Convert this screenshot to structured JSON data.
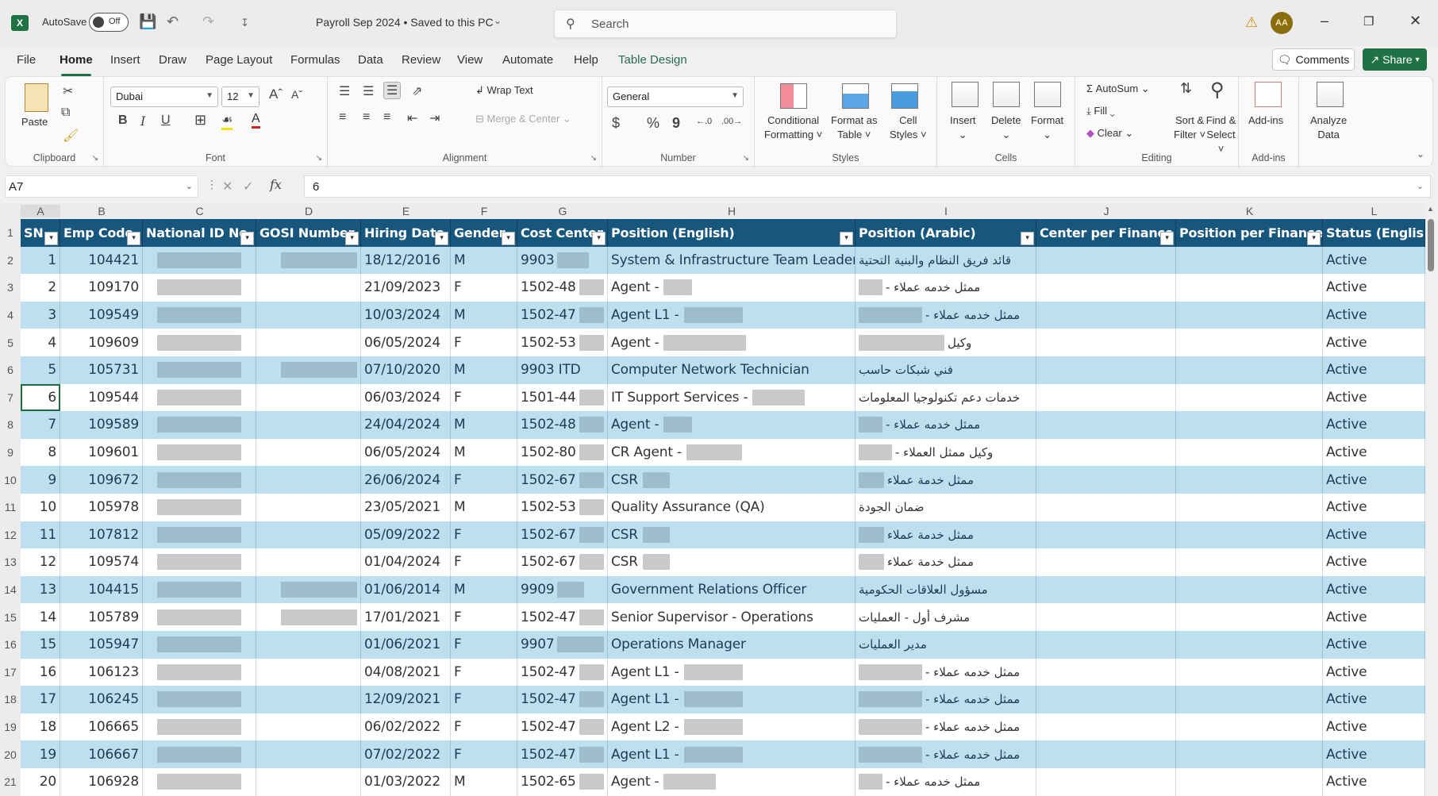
{
  "titlebar": {
    "app_icon": "X",
    "autosave_label": "AutoSave",
    "autosave_state": "Off",
    "doc_title": "Payroll Sep 2024 • Saved to this PC",
    "search_placeholder": "Search",
    "avatar_initials": "AA"
  },
  "tabs": [
    "File",
    "Home",
    "Insert",
    "Draw",
    "Page Layout",
    "Formulas",
    "Data",
    "Review",
    "View",
    "Automate",
    "Help",
    "Table Design"
  ],
  "active_tab": "Home",
  "actions": {
    "comments": "Comments",
    "share": "Share"
  },
  "ribbon": {
    "clipboard": {
      "label": "Clipboard",
      "paste": "Paste"
    },
    "font": {
      "label": "Font",
      "font_name": "Dubai",
      "font_size": "12",
      "bold": "B",
      "italic": "I",
      "underline": "U"
    },
    "alignment": {
      "label": "Alignment",
      "wrap_text": "Wrap Text",
      "merge_center": "Merge & Center"
    },
    "number": {
      "label": "Number",
      "format": "General",
      "currency": "$",
      "percent": "%",
      "comma": "9"
    },
    "styles": {
      "label": "Styles",
      "conditional": [
        "Conditional",
        "Formatting ˅"
      ],
      "format_table": [
        "Format as",
        "Table ˅"
      ],
      "cell_styles": [
        "Cell",
        "Styles ˅"
      ]
    },
    "cells": {
      "label": "Cells",
      "insert": "Insert",
      "delete": "Delete",
      "format": "Format"
    },
    "editing": {
      "label": "Editing",
      "autosum": "AutoSum",
      "fill": "Fill",
      "clear": "Clear",
      "sort_filter": [
        "Sort &",
        "Filter ˅"
      ],
      "find_select": [
        "Find &",
        "Select ˅"
      ]
    },
    "addins": {
      "label": "Add-ins",
      "addins": "Add-ins"
    },
    "analyze": {
      "label": [
        "Analyze",
        "Data"
      ]
    }
  },
  "formula_bar": {
    "name_box": "A7",
    "fx": "fx",
    "value": "6"
  },
  "columns": [
    "A",
    "B",
    "C",
    "D",
    "E",
    "F",
    "G",
    "H",
    "I",
    "J",
    "K",
    "L"
  ],
  "table": {
    "headers": [
      "SN",
      "Emp Code",
      "National ID No",
      "GOSI Number",
      "Hiring Date",
      "Gender",
      "Cost Center",
      "Position (English)",
      "Position (Arabic)",
      "Center per Finance",
      "Position per Finance",
      "Status (English"
    ],
    "rows": [
      {
        "sn": "1",
        "code": "104421",
        "gosi": true,
        "date": "18/12/2016",
        "g": "M",
        "cc": "9903",
        "ccb": 40,
        "pos": "System & Infrastructure Team Leader",
        "posb": 0,
        "ar": "قائد فريق النظام والبنية التحتية",
        "arb": 0,
        "status": "Active"
      },
      {
        "sn": "2",
        "code": "109170",
        "gosi": false,
        "date": "21/09/2023",
        "g": "F",
        "cc": "1502-48",
        "ccb": 36,
        "pos": "Agent -",
        "posb": 36,
        "ar": "ممثل خدمه عملاء -",
        "arb": 30,
        "status": "Active"
      },
      {
        "sn": "3",
        "code": "109549",
        "gosi": false,
        "date": "10/03/2024",
        "g": "M",
        "cc": "1502-47",
        "ccb": 36,
        "pos": "Agent L1 -",
        "posb": 74,
        "ar": "ممثل خدمه عملاء -",
        "arb": 80,
        "status": "Active"
      },
      {
        "sn": "4",
        "code": "109609",
        "gosi": false,
        "date": "06/05/2024",
        "g": "F",
        "cc": "1502-53",
        "ccb": 36,
        "pos": "Agent -",
        "posb": 104,
        "ar": "وكيل",
        "arb": 108,
        "status": "Active"
      },
      {
        "sn": "5",
        "code": "105731",
        "gosi": true,
        "date": "07/10/2020",
        "g": "M",
        "cc": "9903 ITD",
        "ccb": 0,
        "pos": "Computer Network Technician",
        "posb": 0,
        "ar": "فني شبكات حاسب",
        "arb": 0,
        "status": "Active"
      },
      {
        "sn": "6",
        "code": "109544",
        "gosi": false,
        "date": "06/03/2024",
        "g": "F",
        "cc": "1501-44",
        "ccb": 36,
        "pos": "IT Support Services -",
        "posb": 66,
        "ar": "خدمات دعم تكنولوجيا المعلومات",
        "arb": 0,
        "status": "Active"
      },
      {
        "sn": "7",
        "code": "109589",
        "gosi": false,
        "date": "24/04/2024",
        "g": "M",
        "cc": "1502-48",
        "ccb": 36,
        "pos": "Agent -",
        "posb": 36,
        "ar": "ممثل خدمه عملاء -",
        "arb": 30,
        "status": "Active"
      },
      {
        "sn": "8",
        "code": "109601",
        "gosi": false,
        "date": "06/05/2024",
        "g": "M",
        "cc": "1502-80",
        "ccb": 36,
        "pos": "CR Agent -",
        "posb": 70,
        "ar": "وكيل ممثل العملاء -",
        "arb": 42,
        "status": "Active"
      },
      {
        "sn": "9",
        "code": "109672",
        "gosi": false,
        "date": "26/06/2024",
        "g": "F",
        "cc": "1502-67",
        "ccb": 36,
        "pos": "CSR",
        "posb": 34,
        "ar": "ممثل خدمة عملاء",
        "arb": 32,
        "status": "Active"
      },
      {
        "sn": "10",
        "code": "105978",
        "gosi": false,
        "date": "23/05/2021",
        "g": "M",
        "cc": "1502-53",
        "ccb": 36,
        "pos": "Quality Assurance (QA)",
        "posb": 0,
        "ar": "ضمان الجودة",
        "arb": 0,
        "status": "Active"
      },
      {
        "sn": "11",
        "code": "107812",
        "gosi": false,
        "date": "05/09/2022",
        "g": "F",
        "cc": "1502-67",
        "ccb": 36,
        "pos": "CSR",
        "posb": 34,
        "ar": "ممثل خدمة عملاء",
        "arb": 32,
        "status": "Active"
      },
      {
        "sn": "12",
        "code": "109574",
        "gosi": false,
        "date": "01/04/2024",
        "g": "F",
        "cc": "1502-67",
        "ccb": 36,
        "pos": "CSR",
        "posb": 34,
        "ar": "ممثل خدمة عملاء",
        "arb": 32,
        "status": "Active"
      },
      {
        "sn": "13",
        "code": "104415",
        "gosi": true,
        "date": "01/06/2014",
        "g": "M",
        "cc": "9909",
        "ccb": 34,
        "pos": "Government Relations Officer",
        "posb": 0,
        "ar": "مسؤول العلاقات الحكومية",
        "arb": 0,
        "status": "Active"
      },
      {
        "sn": "14",
        "code": "105789",
        "gosi": true,
        "date": "17/01/2021",
        "g": "F",
        "cc": "1502-47",
        "ccb": 36,
        "pos": "Senior Supervisor - Operations",
        "posb": 0,
        "ar": "مشرف أول - العمليات",
        "arb": 0,
        "status": "Active"
      },
      {
        "sn": "15",
        "code": "105947",
        "gosi": false,
        "date": "01/06/2021",
        "g": "F",
        "cc": "9907",
        "ccb": 66,
        "pos": "Operations Manager",
        "posb": 0,
        "ar": "مدير العمليات",
        "arb": 0,
        "status": "Active"
      },
      {
        "sn": "16",
        "code": "106123",
        "gosi": false,
        "date": "04/08/2021",
        "g": "F",
        "cc": "1502-47",
        "ccb": 36,
        "pos": "Agent L1 -",
        "posb": 74,
        "ar": "ممثل خدمه عملاء -",
        "arb": 80,
        "status": "Active"
      },
      {
        "sn": "17",
        "code": "106245",
        "gosi": false,
        "date": "12/09/2021",
        "g": "F",
        "cc": "1502-47",
        "ccb": 36,
        "pos": "Agent L1 -",
        "posb": 74,
        "ar": "ممثل خدمه عملاء -",
        "arb": 80,
        "status": "Active"
      },
      {
        "sn": "18",
        "code": "106665",
        "gosi": false,
        "date": "06/02/2022",
        "g": "F",
        "cc": "1502-47",
        "ccb": 36,
        "pos": "Agent L2 -",
        "posb": 74,
        "ar": "ممثل خدمه عملاء -",
        "arb": 80,
        "status": "Active"
      },
      {
        "sn": "19",
        "code": "106667",
        "gosi": false,
        "date": "07/02/2022",
        "g": "F",
        "cc": "1502-47",
        "ccb": 36,
        "pos": "Agent L1 -",
        "posb": 74,
        "ar": "ممثل خدمه عملاء -",
        "arb": 80,
        "status": "Active"
      },
      {
        "sn": "20",
        "code": "106928",
        "gosi": false,
        "date": "01/03/2022",
        "g": "M",
        "cc": "1502-65",
        "ccb": 36,
        "pos": "Agent -",
        "posb": 66,
        "ar": "ممثل خدمه عملاء -",
        "arb": 30,
        "status": "Active"
      }
    ]
  },
  "selected_cell": "A7",
  "colors": {
    "header": "#17577e",
    "band": "#bde0f1",
    "accent": "#1f7244"
  }
}
